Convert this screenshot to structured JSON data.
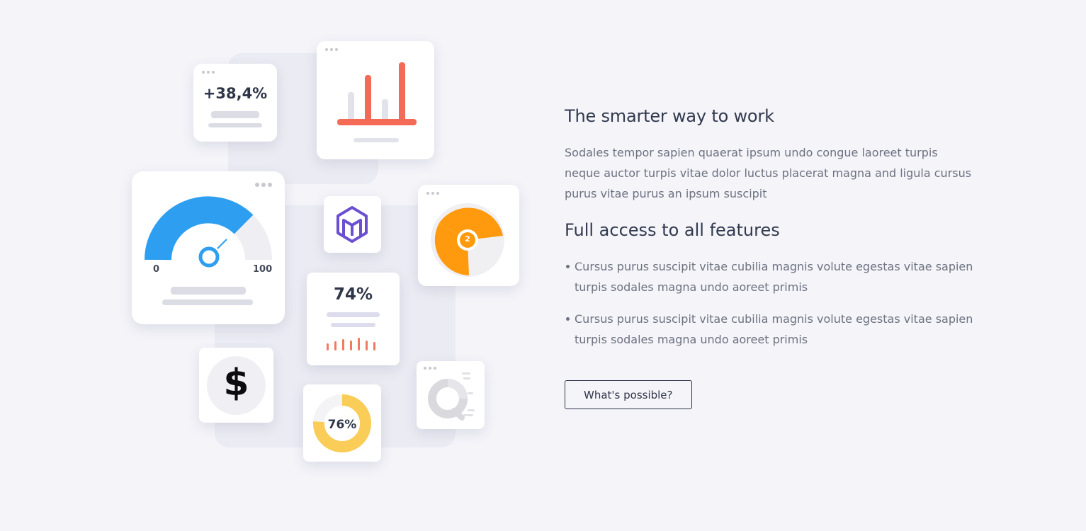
{
  "illustration": {
    "growth_stat": "+38,4%",
    "gauge_min": "0",
    "gauge_max": "100",
    "percent_stat": "74%",
    "donut_percent": "76%",
    "donut_value": 0.76,
    "pie_badge": "2",
    "currency_symbol": "$",
    "icons": [
      "bar-chart-icon",
      "gauge-icon",
      "cube-logo-icon",
      "pie-chart-icon",
      "dollar-icon",
      "donut-chart-icon",
      "ring-chart-icon"
    ],
    "colors": {
      "red": "#f36a56",
      "blue": "#2e9ff0",
      "orange": "#ff9a0e",
      "yellow": "#f9cd57",
      "purple": "#6c4fd1"
    }
  },
  "content": {
    "heading_main": "The smarter way to work",
    "intro": "Sodales tempor sapien quaerat ipsum undo congue laoreet turpis neque auctor turpis vitae dolor luctus placerat magna and ligula cursus purus vitae purus an ipsum suscipit",
    "heading_features": "Full access to all features",
    "features": [
      "Cursus purus suscipit vitae cubilia magnis volute egestas vitae sapien turpis sodales magna undo aoreet primis",
      "Cursus purus suscipit vitae cubilia magnis volute egestas vitae sapien turpis sodales magna undo aoreet primis"
    ],
    "cta_label": "What's possible?"
  }
}
